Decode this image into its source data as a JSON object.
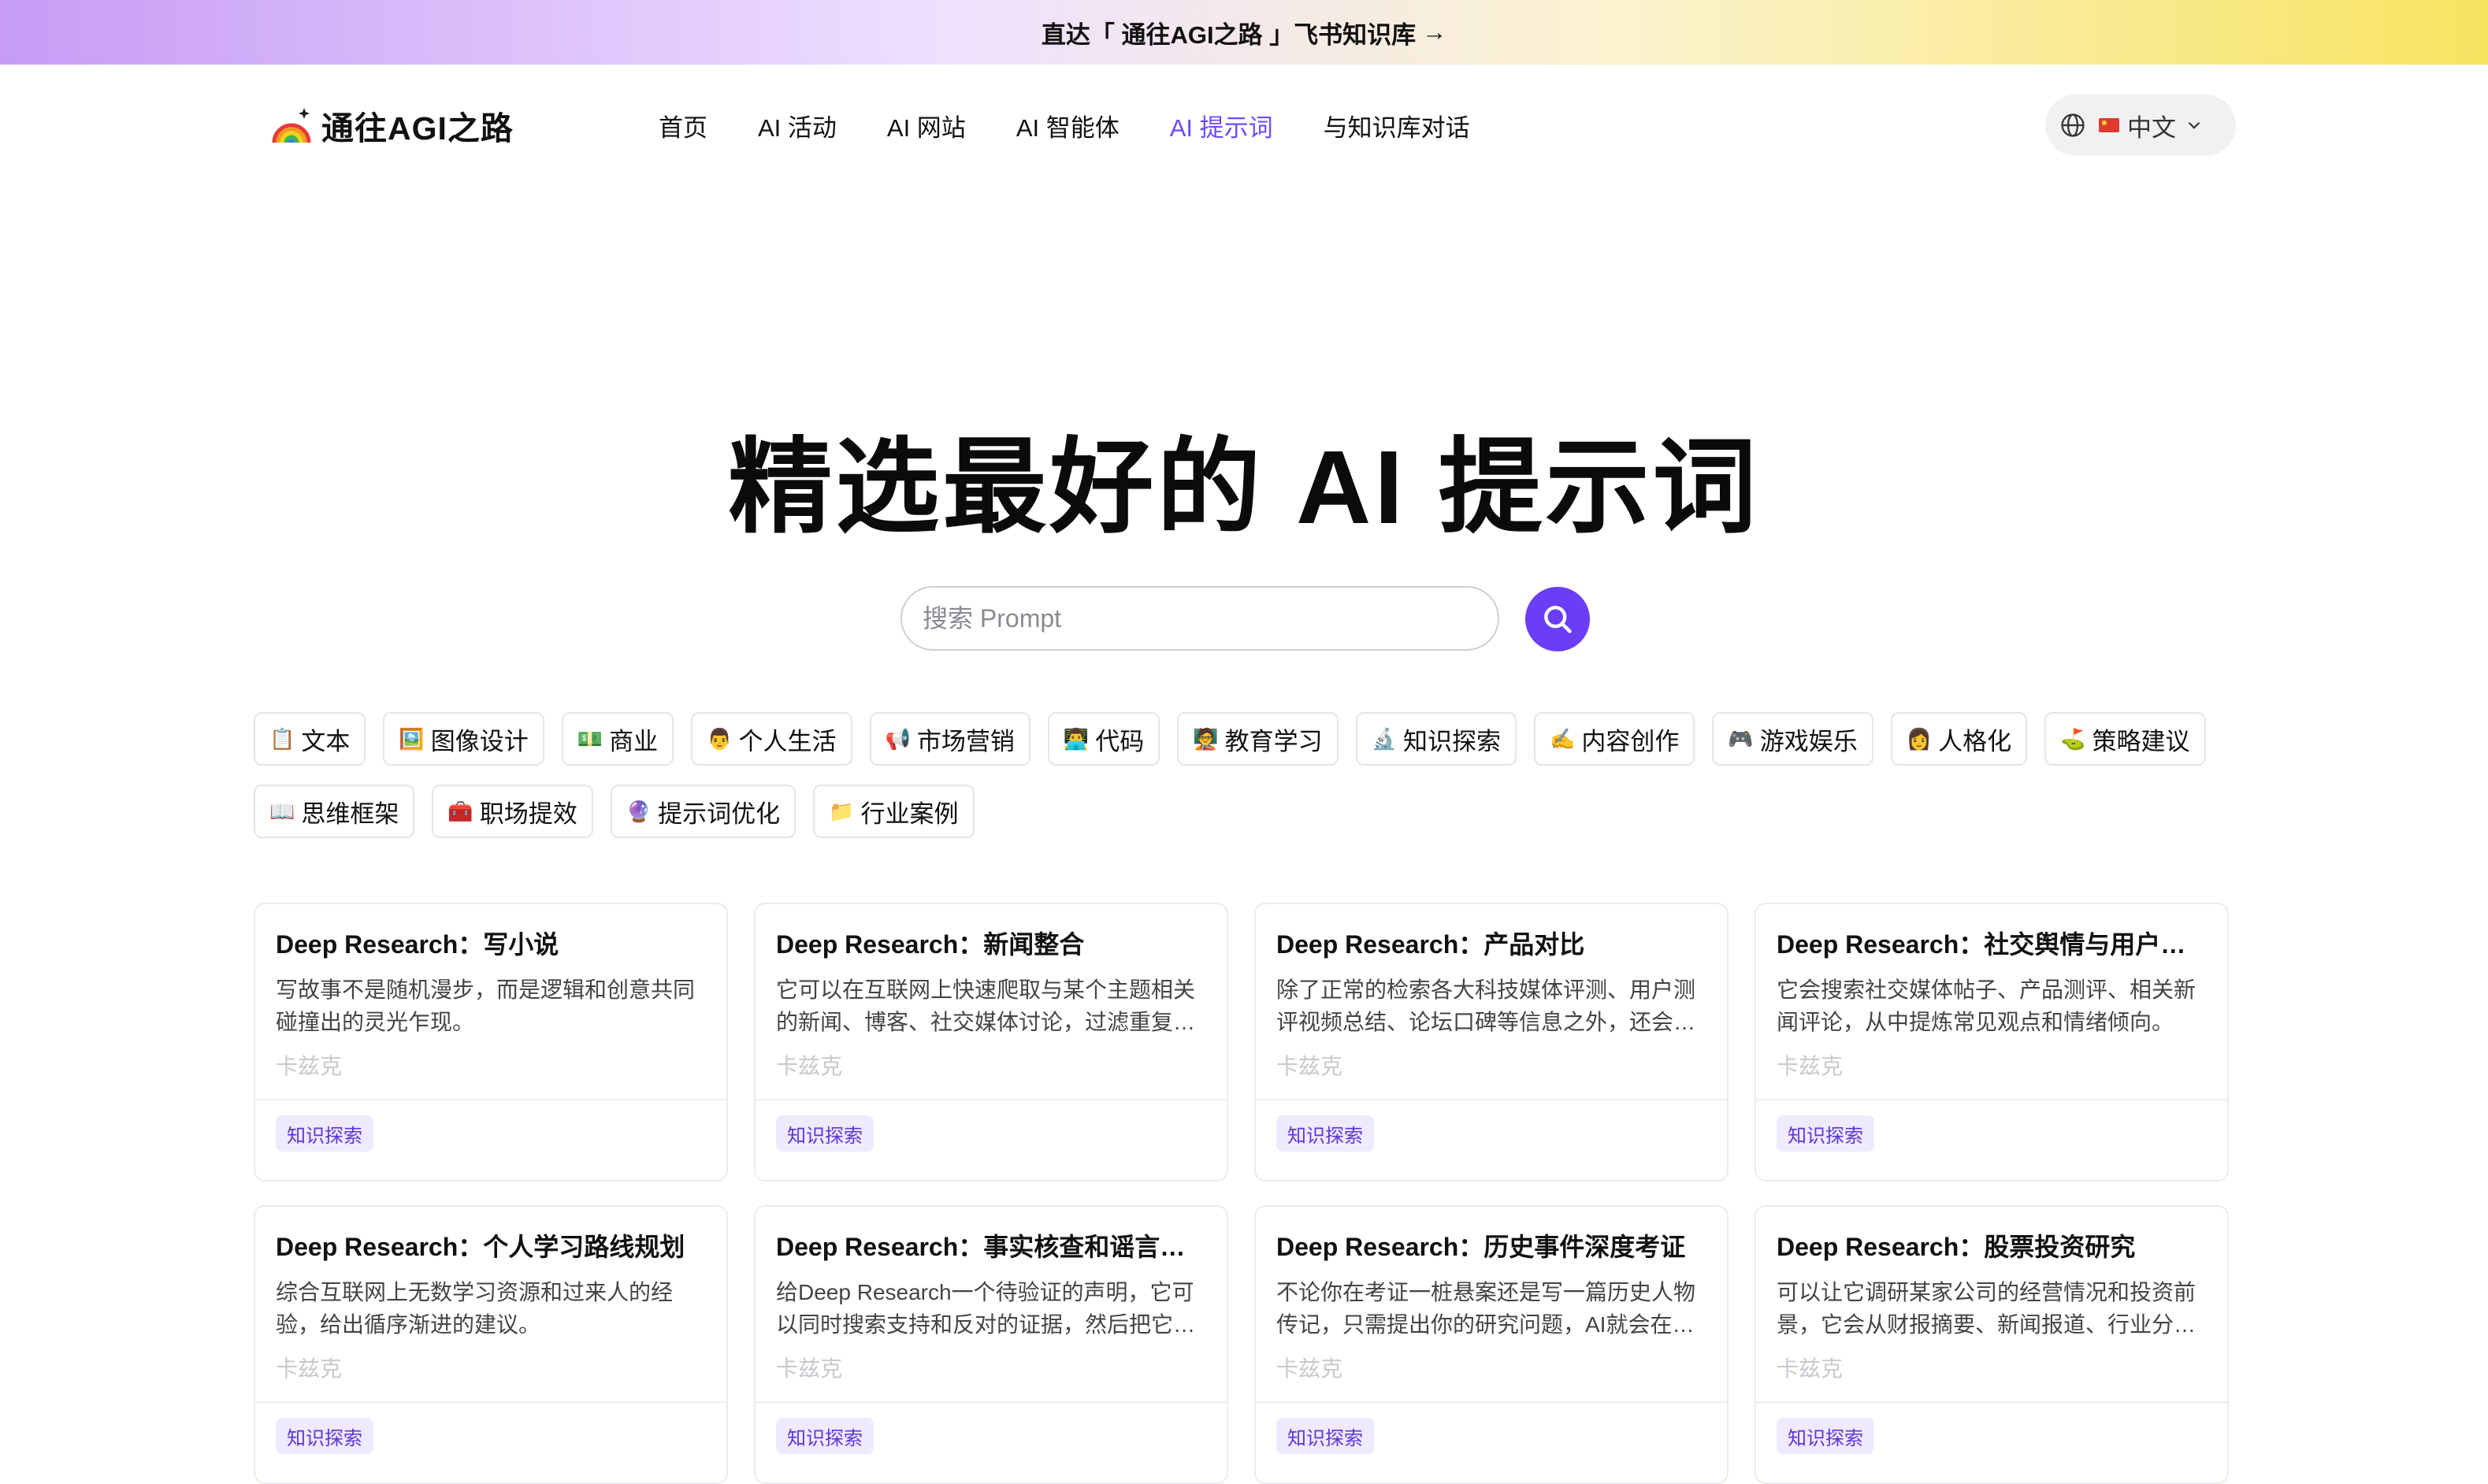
{
  "banner": {
    "text": "直达「 通往AGI之路 」飞书知识库",
    "arrow": "→"
  },
  "header": {
    "logo_text": "通往AGI之路",
    "nav": [
      "首页",
      "AI 活动",
      "AI 网站",
      "AI 智能体",
      "AI 提示词",
      "与知识库对话"
    ],
    "active_nav": "AI 提示词",
    "language": "中文"
  },
  "hero": {
    "title": "精选最好的 AI 提示词",
    "search_placeholder": "搜索 Prompt"
  },
  "tags": {
    "row1": [
      {
        "emoji": "📋",
        "label": "文本"
      },
      {
        "emoji": "🖼️",
        "label": "图像设计"
      },
      {
        "emoji": "💵",
        "label": "商业"
      },
      {
        "emoji": "👨",
        "label": "个人生活"
      },
      {
        "emoji": "📢",
        "label": "市场营销"
      },
      {
        "emoji": "👨‍💻",
        "label": "代码"
      },
      {
        "emoji": "🧑‍🏫",
        "label": "教育学习"
      },
      {
        "emoji": "🔬",
        "label": "知识探索"
      },
      {
        "emoji": "✍️",
        "label": "内容创作"
      },
      {
        "emoji": "🎮",
        "label": "游戏娱乐"
      },
      {
        "emoji": "👩",
        "label": "人格化"
      },
      {
        "emoji": "⛳",
        "label": "策略建议"
      }
    ],
    "row2": [
      {
        "emoji": "📖",
        "label": "思维框架"
      },
      {
        "emoji": "🧰",
        "label": "职场提效"
      },
      {
        "emoji": "🔮",
        "label": "提示词优化"
      },
      {
        "emoji": "📁",
        "label": "行业案例"
      }
    ]
  },
  "cards": [
    {
      "title": "Deep Research：写小说",
      "desc": "写故事不是随机漫步，而是逻辑和创意共同碰撞出的灵光乍现。",
      "author": "卡兹克",
      "badge": "知识探索"
    },
    {
      "title": "Deep Research：新闻整合",
      "desc": "它可以在互联网上快速爬取与某个主题相关的新闻、博客、社交媒体讨论，过滤重复信息，提炼出核心观点。",
      "author": "卡兹克",
      "badge": "知识探索"
    },
    {
      "title": "Deep Research：产品对比",
      "desc": "除了正常的检索各大科技媒体评测、用户测评视频总结、论坛口碑等信息之外，还会帮你做出对比。",
      "author": "卡兹克",
      "badge": "知识探索"
    },
    {
      "title": "Deep Research：社交舆情与用户情绪分析",
      "desc": "它会搜索社交媒体帖子、产品测评、相关新闻评论，从中提炼常见观点和情绪倾向。",
      "author": "卡兹克",
      "badge": "知识探索"
    },
    {
      "title": "Deep Research：个人学习路线规划",
      "desc": "综合互联网上无数学习资源和过来人的经验，给出循序渐进的建议。",
      "author": "卡兹克",
      "badge": "知识探索"
    },
    {
      "title": "Deep Research：事实核查和谣言粉碎",
      "desc": "给Deep Research一个待验证的声明，它可以同时搜索支持和反对的证据，然后把它们整理清楚。",
      "author": "卡兹克",
      "badge": "知识探索"
    },
    {
      "title": "Deep Research：历史事件深度考证",
      "desc": "不论你在考证一桩悬案还是写一篇历史人物传记，只需提出你的研究问题，AI就会在海量史料中检索。",
      "author": "卡兹克",
      "badge": "知识探索"
    },
    {
      "title": "Deep Research：股票投资研究",
      "desc": "可以让它调研某家公司的经营情况和投资前景，它会从财报摘要、新闻报道、行业分析中汇总信息。",
      "author": "卡兹克",
      "badge": "知识探索"
    }
  ]
}
